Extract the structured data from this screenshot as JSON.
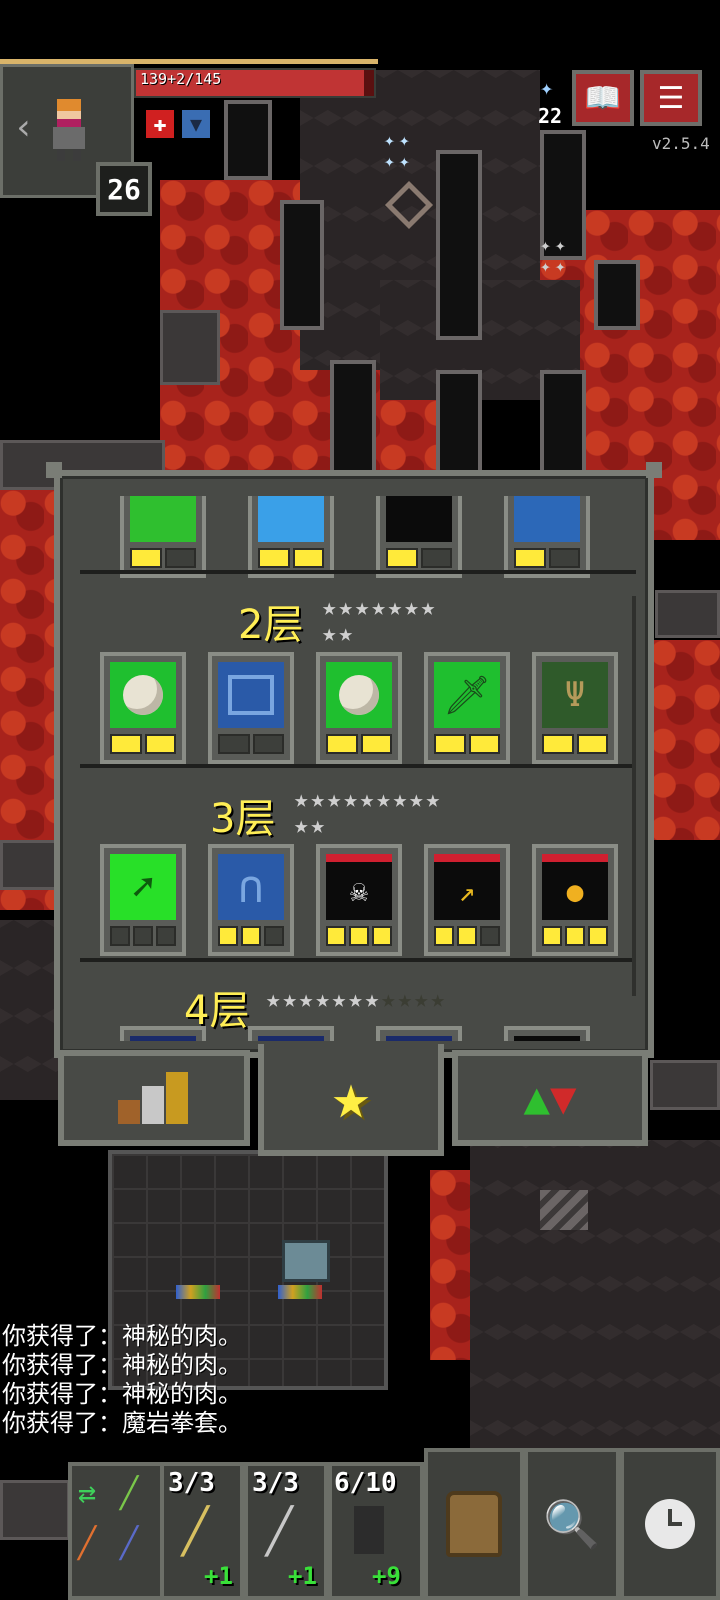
{
  "hud": {
    "hp_text": "139+2/145",
    "level": "26",
    "keys": "22",
    "version": "v2.5.4",
    "buffs": [
      "burning-buff-icon",
      "shield-buff-icon"
    ]
  },
  "journal": {
    "floors": [
      {
        "title": "2层",
        "stars_lit": 9,
        "stars_total": 9,
        "items": [
          {
            "icon": "ration-icon",
            "pips": [
              1,
              1
            ]
          },
          {
            "icon": "scroll-icon",
            "pips": [
              0,
              0
            ]
          },
          {
            "icon": "ration-icon",
            "pips": [
              1,
              1
            ]
          },
          {
            "icon": "dagger-icon",
            "pips": [
              1,
              1
            ]
          },
          {
            "icon": "tree-icon",
            "pips": [
              1,
              1
            ]
          }
        ]
      },
      {
        "title": "3层",
        "stars_lit": 11,
        "stars_total": 11,
        "items": [
          {
            "icon": "leaf-arrow-icon",
            "pips": [
              0,
              0,
              0
            ]
          },
          {
            "icon": "ghost-arch-icon",
            "pips": [
              1,
              1,
              0
            ]
          },
          {
            "icon": "skull-card-icon",
            "pips": [
              1,
              1,
              1
            ]
          },
          {
            "icon": "arrow-card-icon",
            "pips": [
              1,
              1,
              0
            ]
          },
          {
            "icon": "coin-card-icon",
            "pips": [
              1,
              1,
              1
            ]
          }
        ]
      },
      {
        "title": "4层",
        "stars_lit": 7,
        "stars_total": 11
      }
    ]
  },
  "log": [
    "你获得了：神秘的肉。",
    "你获得了：神秘的肉。",
    "你获得了：神秘的肉。",
    "你获得了：魔岩拳套。"
  ],
  "quickslots": [
    {
      "count": "3/3",
      "bonus": "+1"
    },
    {
      "count": "3/3",
      "bonus": "+1"
    },
    {
      "count": "6/10",
      "bonus": "+9"
    }
  ],
  "colors": {
    "accent": "#ffee55",
    "hp": "#c03434",
    "pip_on": "#ffea3a"
  }
}
